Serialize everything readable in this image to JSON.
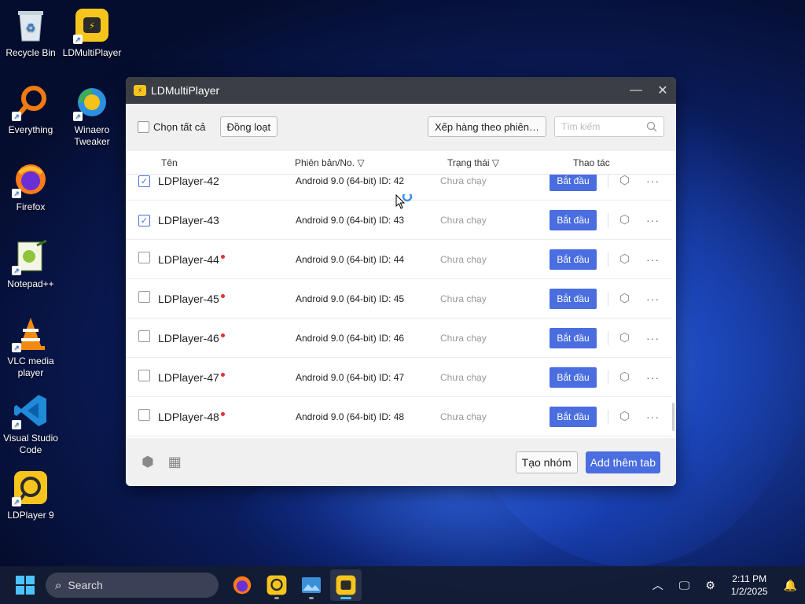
{
  "desktop": {
    "icons": [
      {
        "label": "Recycle Bin"
      },
      {
        "label": "LDMultiPlayer"
      },
      {
        "label": "Everything"
      },
      {
        "label": "Winaero Tweaker"
      },
      {
        "label": "Firefox"
      },
      {
        "label": "Notepad++"
      },
      {
        "label": "VLC media player"
      },
      {
        "label": "Visual Studio Code"
      },
      {
        "label": "LDPlayer 9"
      }
    ]
  },
  "window": {
    "title": "LDMultiPlayer",
    "minimize": "—",
    "close": "✕",
    "toolbar": {
      "select_all_label": "Chọn tất cả",
      "batch_button": "Đồng loạt",
      "sort_button": "Xếp hàng theo phiên…",
      "search_placeholder": "Tìm kiếm"
    },
    "table": {
      "headers": {
        "name": "Tên",
        "version": "Phiên bản/No.",
        "status": "Trạng thái",
        "actions": "Thao tác"
      },
      "rows": [
        {
          "name": "LDPlayer-42",
          "version": "Android 9.0 (64-bit) ID: 42",
          "status": "Chưa chạy",
          "start": "Bắt đầu",
          "checked": true,
          "dot": false
        },
        {
          "name": "LDPlayer-43",
          "version": "Android 9.0 (64-bit) ID: 43",
          "status": "Chưa chạy",
          "start": "Bắt đầu",
          "checked": true,
          "dot": false
        },
        {
          "name": "LDPlayer-44",
          "version": "Android 9.0 (64-bit) ID: 44",
          "status": "Chưa chạy",
          "start": "Bắt đầu",
          "checked": false,
          "dot": true
        },
        {
          "name": "LDPlayer-45",
          "version": "Android 9.0 (64-bit) ID: 45",
          "status": "Chưa chạy",
          "start": "Bắt đầu",
          "checked": false,
          "dot": true
        },
        {
          "name": "LDPlayer-46",
          "version": "Android 9.0 (64-bit) ID: 46",
          "status": "Chưa chạy",
          "start": "Bắt đầu",
          "checked": false,
          "dot": true
        },
        {
          "name": "LDPlayer-47",
          "version": "Android 9.0 (64-bit) ID: 47",
          "status": "Chưa chạy",
          "start": "Bắt đầu",
          "checked": false,
          "dot": true
        },
        {
          "name": "LDPlayer-48",
          "version": "Android 9.0 (64-bit) ID: 48",
          "status": "Chưa chạy",
          "start": "Bắt đầu",
          "checked": false,
          "dot": true
        }
      ]
    },
    "footer": {
      "group_button": "Tạo nhóm",
      "add_tab_button": "Add thêm tab"
    }
  },
  "taskbar": {
    "search_label": "Search",
    "time": "2:11 PM",
    "date": "1/2/2025"
  },
  "colors": {
    "accent": "#4a6ee0",
    "titlebar": "#3b3e45",
    "status_dot": "#e03030"
  }
}
